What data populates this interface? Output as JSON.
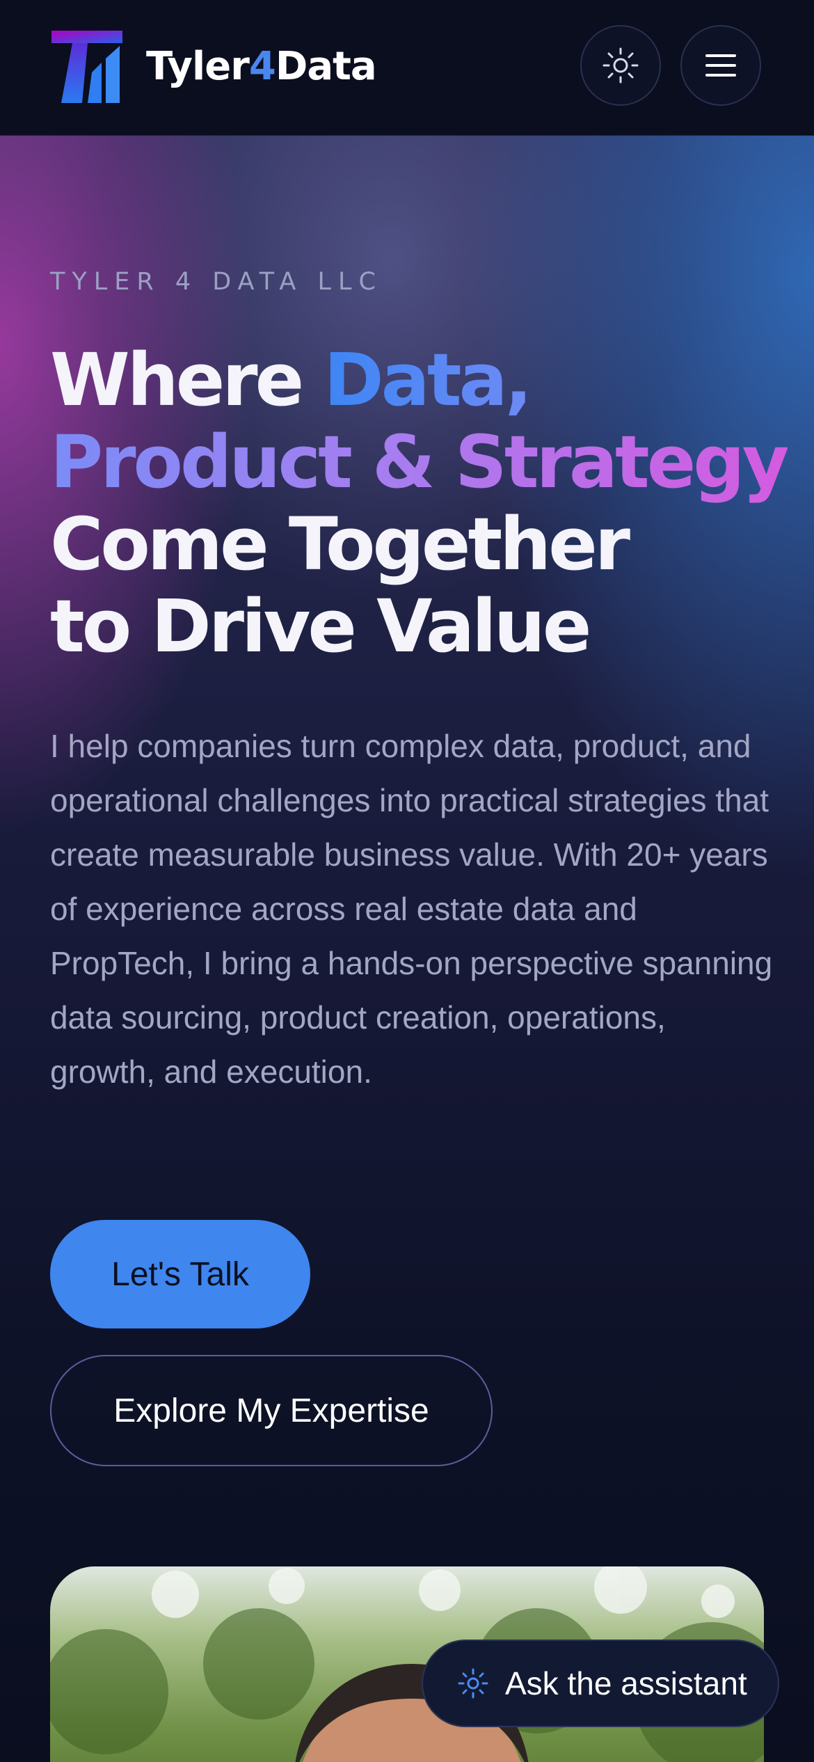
{
  "header": {
    "brand_prefix": "Tyler",
    "brand_accent": "4",
    "brand_suffix": "Data",
    "logo_icon": "T-bar-chart-logo",
    "theme_icon": "sun-icon",
    "menu_icon": "hamburger-menu-icon"
  },
  "hero": {
    "eyebrow": "TYLER 4 DATA LLC",
    "headline": {
      "line1_plain": "Where ",
      "line1_accent": "Data,",
      "line2_accent": "Product & Strategy",
      "line3": "Come Together",
      "line4": "to Drive Value"
    },
    "intro": "I help companies turn complex data, product, and operational challenges into practical strategies that create measurable business value. With 20+ years of experience across real estate data and PropTech, I bring a hands-on perspective spanning data sourcing, product creation, operations, growth, and execution.",
    "primary_cta": "Let's Talk",
    "secondary_cta": "Explore My Expertise"
  },
  "assistant": {
    "label": "Ask the assistant",
    "icon": "sparkle-sun-icon"
  },
  "colors": {
    "background": "#0a0e1f",
    "accent_blue": "#3f86ef",
    "accent_pink": "#d45be0",
    "text_muted": "#a3a6c4"
  }
}
